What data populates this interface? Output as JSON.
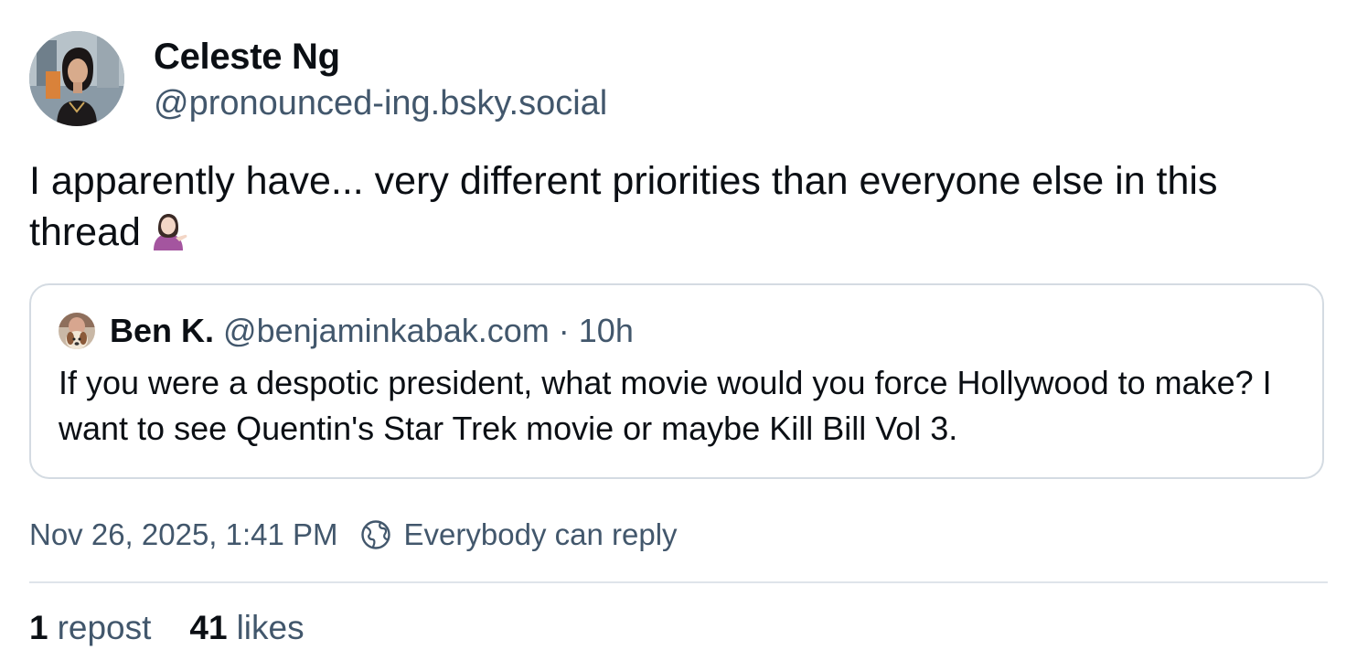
{
  "author": {
    "name": "Celeste Ng",
    "handle": "@pronounced-ing.bsky.social"
  },
  "post": {
    "text": "I apparently have... very different priorities than everyone else in this thread",
    "emoji": "person-tipping-hand-emoji"
  },
  "quote": {
    "name": "Ben K.",
    "handle": "@benjaminkabak.com",
    "separator": "·",
    "time": "10h",
    "text": "If you were a despotic president, what movie would you force Hollywood to make? I want to see Quentin's Star Trek movie or maybe Kill Bill Vol 3."
  },
  "meta": {
    "timestamp": "Nov 26, 2025, 1:41 PM",
    "reply_setting": "Everybody can reply",
    "reply_icon": "globe-icon"
  },
  "stats": {
    "reposts_count": "1",
    "reposts_label": "repost",
    "likes_count": "41",
    "likes_label": "likes"
  },
  "colors": {
    "text_primary": "#0b0f14",
    "text_secondary": "#42576c",
    "border": "#d4dbe2",
    "divider": "#dfe4ea"
  }
}
